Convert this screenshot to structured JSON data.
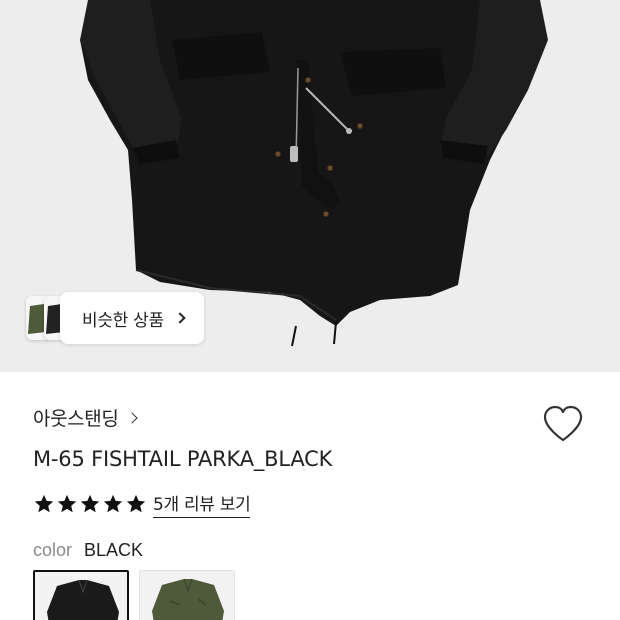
{
  "product": {
    "brand": "아웃스탠딩",
    "title": "M-65 FISHTAIL PARKA_BLACK",
    "rating_stars": 5,
    "review_link": "5개 리뷰 보기",
    "color_label": "color",
    "color_value": "BLACK",
    "swatches": [
      {
        "color": "#1a1a1a",
        "selected": true
      },
      {
        "color": "#4e5a3a",
        "selected": false
      }
    ]
  },
  "hero": {
    "similar_label": "비슷한 상품",
    "background": "#ededed"
  },
  "icons": {
    "heart": "heart-outline-icon",
    "star": "star-filled-icon",
    "chevron": "chevron-right-icon"
  },
  "colors": {
    "text": "#222222",
    "muted": "#8a8a8a",
    "star": "#111111",
    "parka_black": "#161616",
    "olive": "#4e5a3a"
  }
}
